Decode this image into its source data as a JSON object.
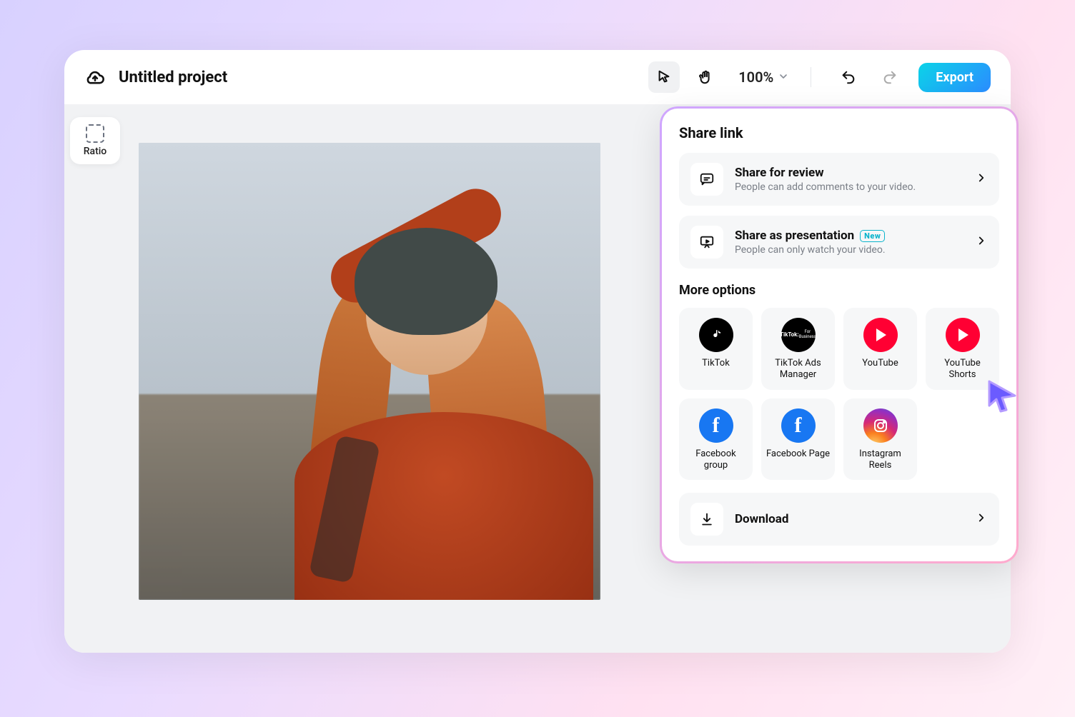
{
  "header": {
    "project_title": "Untitled project",
    "zoom_level": "100%",
    "export_label": "Export"
  },
  "sidebar_tool": {
    "ratio_label": "Ratio"
  },
  "share_panel": {
    "heading": "Share link",
    "review": {
      "title": "Share for review",
      "subtitle": "People can add comments to your video."
    },
    "presentation": {
      "title": "Share as presentation",
      "badge": "New",
      "subtitle": "People can only watch your video."
    },
    "more_heading": "More options",
    "options": {
      "tiktok": "TikTok",
      "tiktok_ads": "TikTok Ads Manager",
      "youtube": "YouTube",
      "youtube_shorts": "YouTube Shorts",
      "fb_group": "Facebook group",
      "fb_page": "Facebook Page",
      "ig_reels": "Instagram Reels"
    },
    "download_label": "Download"
  },
  "colors": {
    "accent_gradient_from": "#0bd3e8",
    "accent_gradient_to": "#2b8cff",
    "panel_border_from": "#cfa6ff",
    "panel_border_to": "#ffaacd",
    "badge_color": "#0bb4cc"
  }
}
